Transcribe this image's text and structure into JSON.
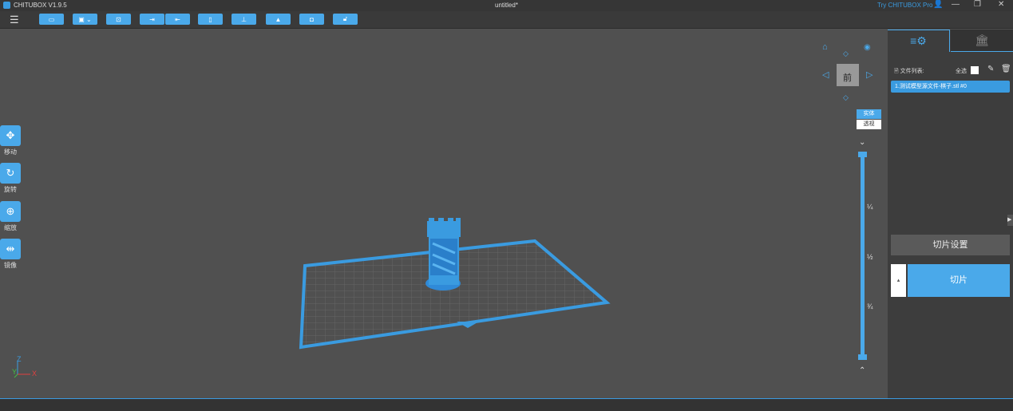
{
  "window": {
    "app_title": "CHITUBOX V1.9.5",
    "doc_title": "untitled*",
    "try_pro": "Try CHITUBOX Pro"
  },
  "toolbar": {
    "menu_icon": "hamburger-icon",
    "buttons": [
      "open-icon",
      "save-icon",
      "select-all-icon",
      "import-icon",
      "export-icon",
      "file-icon",
      "layout-icon",
      "support-icon",
      "hollow-icon",
      "lock-icon"
    ]
  },
  "left_tools": [
    {
      "label": "移动",
      "icon": "move-icon"
    },
    {
      "label": "旋转",
      "icon": "rotate-icon"
    },
    {
      "label": "缩放",
      "icon": "scale-icon"
    },
    {
      "label": "镜像",
      "icon": "mirror-icon"
    }
  ],
  "view": {
    "cube_face": "前",
    "solid": "实体",
    "perspective": "透视"
  },
  "slider": {
    "marks": [
      "¼",
      "½",
      "¾"
    ]
  },
  "axes": {
    "z": "Z",
    "y": "Y",
    "x": "X"
  },
  "panel": {
    "file_list_label": "文件列表:",
    "select_all": "全选",
    "files": [
      "1.测试模型源文件-棋子.stl #0"
    ],
    "slice_settings": "切片设置",
    "slice": "切片"
  },
  "colors": {
    "accent": "#4aa9ea",
    "background": "#505050"
  }
}
